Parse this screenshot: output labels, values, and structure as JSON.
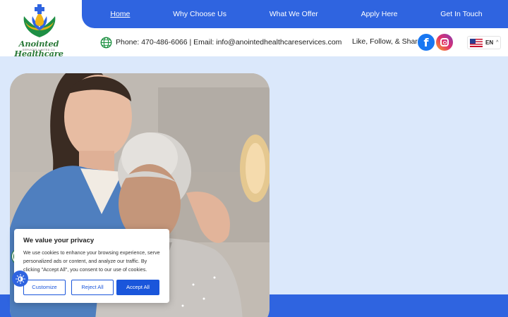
{
  "brand": {
    "name": "Anointed Healthcare",
    "subtitle": "SERVICES LIMITED CO"
  },
  "nav": {
    "items": [
      {
        "label": "Home"
      },
      {
        "label": "Why Choose Us"
      },
      {
        "label": "What We Offer"
      },
      {
        "label": "Apply Here"
      },
      {
        "label": "Get In Touch"
      }
    ]
  },
  "contact": {
    "text": "Phone: 470-486-6066 | Email: info@anointedhealthcareservices.com",
    "icon": "globe-icon"
  },
  "social": {
    "label": "Like, Follow, & Share!",
    "facebook_glyph": "f"
  },
  "language": {
    "code": "EN",
    "caret": "^"
  },
  "cookie": {
    "title": "We value your privacy",
    "text": "We use cookies to enhance your browsing experience, serve personalized ads or content, and analyze our traffic. By clicking \"Accept All\", you consent to our use of cookies.",
    "customize": "Customize",
    "reject": "Reject All",
    "accept": "Accept All"
  },
  "colors": {
    "primary": "#2f64e0",
    "page_bg": "#dbe8fb",
    "accessibility": "#1a7f3c"
  }
}
